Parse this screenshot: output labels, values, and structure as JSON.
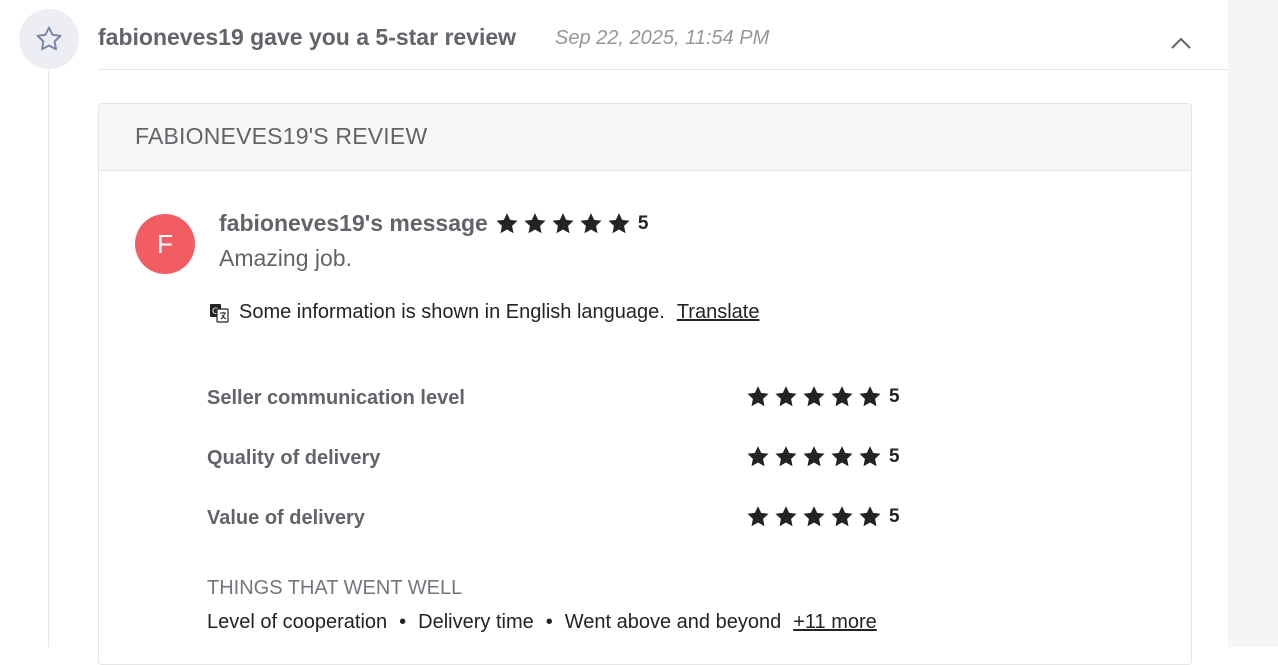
{
  "event": {
    "icon": "star-outline-icon",
    "title": "fabioneves19 gave you a 5-star review",
    "date": "Sep 22, 2025, 11:54 PM",
    "collapse_icon": "chevron-up-icon"
  },
  "review": {
    "header": "FABIONEVES19'S REVIEW",
    "avatar_letter": "F",
    "avatar_color": "#f15d62",
    "message_title": "fabioneves19's message",
    "rating": "5",
    "rating_stars": 5,
    "message": "Amazing job.",
    "translate_notice": "Some information is shown in English language.",
    "translate_link": "Translate",
    "criteria": [
      {
        "label": "Seller communication level",
        "rating": "5"
      },
      {
        "label": "Quality of delivery",
        "rating": "5"
      },
      {
        "label": "Value of delivery",
        "rating": "5"
      }
    ],
    "went_well_title": "THINGS THAT WENT WELL",
    "went_well": [
      "Level of cooperation",
      "Delivery time",
      "Went above and beyond"
    ],
    "more_link": "+11 more",
    "separator": "•"
  },
  "colors": {
    "star": "#222325",
    "muted_text": "#62646a"
  }
}
